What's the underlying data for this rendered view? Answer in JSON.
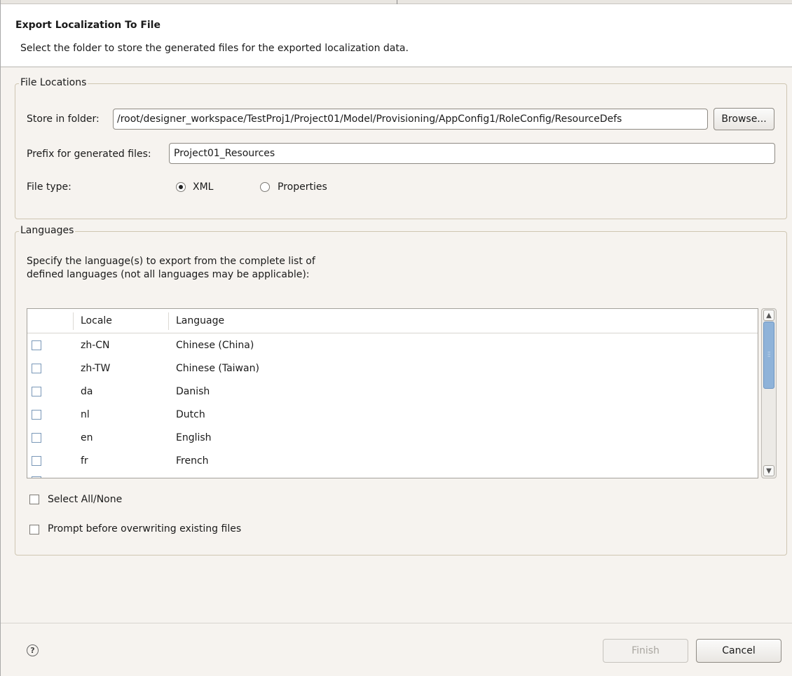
{
  "dialog": {
    "title": "Export Localization To File",
    "subtitle": "Select the folder to store the generated files for the exported localization data."
  },
  "file_locations": {
    "legend": "File Locations",
    "store_label": "Store in folder:",
    "store_value": "/root/designer_workspace/TestProj1/Project01/Model/Provisioning/AppConfig1/RoleConfig/ResourceDefs",
    "browse_label": "Browse...",
    "prefix_label": "Prefix for generated files:",
    "prefix_value": "Project01_Resources",
    "filetype_label": "File type:",
    "xml_label": "XML",
    "properties_label": "Properties",
    "selected_type": "XML"
  },
  "languages": {
    "legend": "Languages",
    "description": "Specify the language(s) to export from the complete list of defined languages (not all languages may be applicable):",
    "columns": [
      "Locale",
      "Language"
    ],
    "rows": [
      {
        "locale": "zh-CN",
        "language": "Chinese (China)",
        "checked": false
      },
      {
        "locale": "zh-TW",
        "language": "Chinese (Taiwan)",
        "checked": false
      },
      {
        "locale": "da",
        "language": "Danish",
        "checked": false
      },
      {
        "locale": "nl",
        "language": "Dutch",
        "checked": false
      },
      {
        "locale": "en",
        "language": "English",
        "checked": false
      },
      {
        "locale": "fr",
        "language": "French",
        "checked": false
      }
    ],
    "select_all_label": "Select All/None",
    "prompt_label": "Prompt before overwriting existing files"
  },
  "footer": {
    "help_icon": "?",
    "finish_label": "Finish",
    "cancel_label": "Cancel"
  },
  "colors": {
    "dialog_bg": "#f6f3ef",
    "scroll_thumb": "#8fb3d9",
    "status_mark": "#e21c1c"
  },
  "icons": [
    "help-icon",
    "scroll-up-icon",
    "scroll-down-icon"
  ]
}
